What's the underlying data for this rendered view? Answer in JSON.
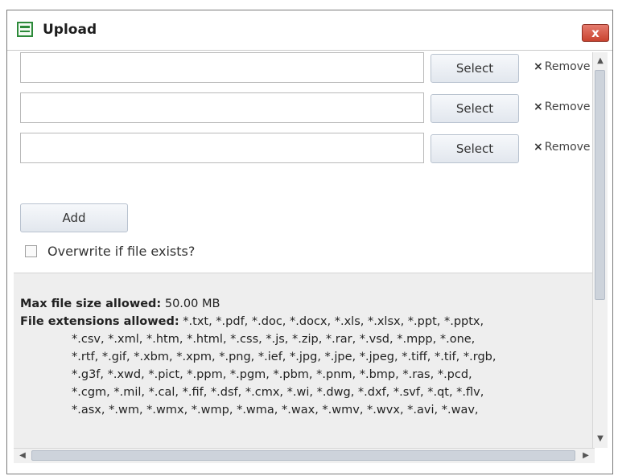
{
  "dialog": {
    "title": "Upload",
    "close_label": "x"
  },
  "file_rows": [
    {
      "value": "",
      "select_label": "Select",
      "remove_label": "Remove"
    },
    {
      "value": "",
      "select_label": "Select",
      "remove_label": "Remove"
    },
    {
      "value": "",
      "select_label": "Select",
      "remove_label": "Remove"
    }
  ],
  "add_label": "Add",
  "overwrite": {
    "label": "Overwrite if file exists?",
    "checked": false
  },
  "info": {
    "max_size_label": "Max file size allowed:",
    "max_size_value": "50.00 MB",
    "extensions_label": "File extensions allowed:",
    "extensions_lines": [
      "*.txt, *.pdf, *.doc, *.docx, *.xls, *.xlsx, *.ppt, *.pptx,",
      "*.csv, *.xml, *.htm, *.html, *.css, *.js, *.zip, *.rar, *.vsd, *.mpp, *.one,",
      "*.rtf, *.gif, *.xbm, *.xpm, *.png, *.ief, *.jpg, *.jpe, *.jpeg, *.tiff, *.tif, *.rgb,",
      "*.g3f, *.xwd, *.pict, *.ppm, *.pgm, *.pbm, *.pnm, *.bmp, *.ras, *.pcd,",
      "*.cgm, *.mil, *.cal, *.fif, *.dsf, *.cmx, *.wi, *.dwg, *.dxf, *.svf, *.qt, *.flv,",
      "*.asx, *.wm, *.wmx, *.wmp, *.wma, *.wax, *.wmv, *.wvx, *.avi, *.wav,"
    ]
  },
  "icons": {
    "title": "upload-form-icon",
    "close": "close-icon",
    "remove": "remove-x-icon",
    "scroll_up": "scroll-up-arrow-icon",
    "scroll_down": "scroll-down-arrow-icon",
    "scroll_left": "scroll-left-arrow-icon",
    "scroll_right": "scroll-right-arrow-icon"
  }
}
